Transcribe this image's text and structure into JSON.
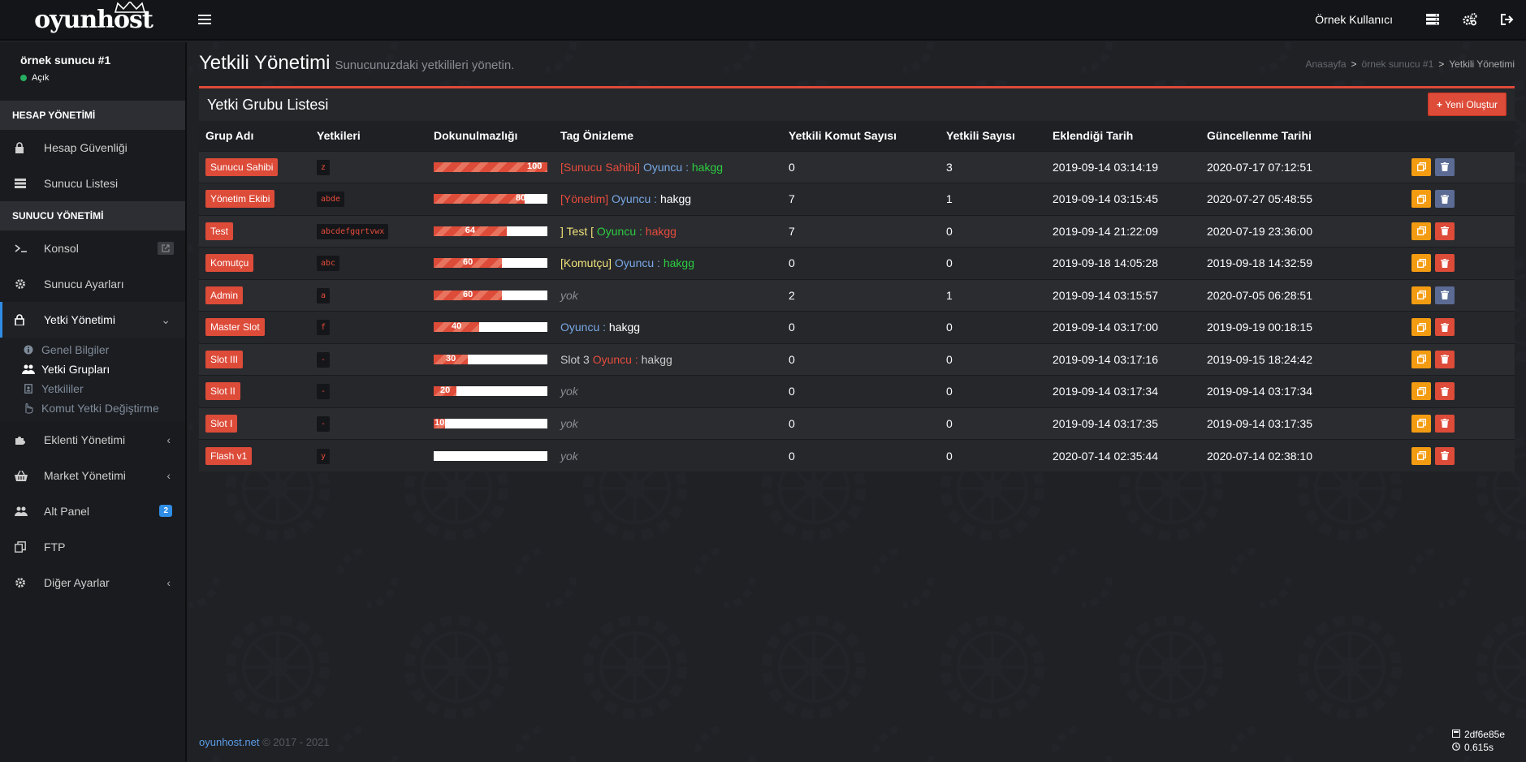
{
  "brand": {
    "logo_text": "oyunhost"
  },
  "header": {
    "user_name": "Örnek Kullanıcı",
    "icons": [
      "server-list-icon",
      "settings-cogs-icon",
      "logout-icon"
    ]
  },
  "sidebar": {
    "server_name": "örnek sunucu #1",
    "server_status": "Açık",
    "sections": {
      "account": "HESAP YÖNETİMİ",
      "server": "SUNUCU YÖNETİMİ"
    },
    "account_items": [
      {
        "label": "Hesap Güvenliği",
        "icon": "lock-icon"
      },
      {
        "label": "Sunucu Listesi",
        "icon": "server-list-icon"
      }
    ],
    "server_items": [
      {
        "label": "Konsol",
        "icon": "terminal-icon"
      },
      {
        "label": "Sunucu Ayarları",
        "icon": "gear-icon"
      },
      {
        "label": "Yetki Yönetimi",
        "icon": "lock-icon"
      }
    ],
    "sub_items": [
      {
        "label": "Genel Bilgiler",
        "icon": "info-icon"
      },
      {
        "label": "Yetki Grupları",
        "icon": "users-icon"
      },
      {
        "label": "Yetkililer",
        "icon": "badge-icon"
      },
      {
        "label": "Komut Yetki Değiştirme",
        "icon": "hand-icon"
      }
    ],
    "lower_items": [
      {
        "label": "Eklenti Yönetimi",
        "icon": "puzzle-icon"
      },
      {
        "label": "Market Yönetimi",
        "icon": "basket-icon"
      },
      {
        "label": "Alt Panel",
        "icon": "users-icon",
        "badge": "2"
      },
      {
        "label": "FTP",
        "icon": "copy-icon"
      },
      {
        "label": "Diğer Ayarlar",
        "icon": "gear-icon"
      }
    ]
  },
  "page": {
    "title": "Yetkili Yönetimi",
    "subtitle": "Sunucunuzdaki yetkilileri yönetin.",
    "breadcrumb": [
      "Anasayfa",
      "örnek sunucu #1",
      "Yetkili Yönetimi"
    ]
  },
  "box": {
    "title": "Yetki Grubu Listesi",
    "new_button": "Yeni Oluştur"
  },
  "table": {
    "columns": [
      "Grup Adı",
      "Yetkileri",
      "Dokunulmazlığı",
      "Tag Önizleme",
      "Yetkili Komut Sayısı",
      "Yetkili Sayısı",
      "Eklendiği Tarih",
      "Güncellenme Tarihi"
    ],
    "rows": [
      {
        "name": "Sunucu Sahibi",
        "flags": "z",
        "immunity": 100,
        "tag": [
          [
            "[Sunucu Sahibi] ",
            "red"
          ],
          [
            "Oyuncu : ",
            "blue"
          ],
          [
            "hakgg",
            "green"
          ]
        ],
        "cmd_count": "0",
        "admin_count": "3",
        "added": "2019-09-14 03:14:19",
        "updated": "2020-07-17 07:12:51",
        "deletable": false
      },
      {
        "name": "Yönetim Ekibi",
        "flags": "abde",
        "immunity": 80,
        "tag": [
          [
            "[Yönetim] ",
            "red"
          ],
          [
            "Oyuncu : ",
            "blue"
          ],
          [
            "hakgg",
            "white"
          ]
        ],
        "cmd_count": "7",
        "admin_count": "1",
        "added": "2019-09-14 03:15:45",
        "updated": "2020-07-27 05:48:55",
        "deletable": false
      },
      {
        "name": "Test",
        "flags": "abcdefgqrtvwx",
        "immunity": 64,
        "tag": [
          [
            "] Test [ ",
            "yellow"
          ],
          [
            "Oyuncu : ",
            "green"
          ],
          [
            "hakgg",
            "red"
          ]
        ],
        "cmd_count": "7",
        "admin_count": "0",
        "added": "2019-09-14 21:22:09",
        "updated": "2020-07-19 23:36:00",
        "deletable": true
      },
      {
        "name": "Komutçu",
        "flags": "abc",
        "immunity": 60,
        "tag": [
          [
            "[Komutçu] ",
            "yellow"
          ],
          [
            "Oyuncu : ",
            "blue"
          ],
          [
            "hakgg",
            "green"
          ]
        ],
        "cmd_count": "0",
        "admin_count": "0",
        "added": "2019-09-18 14:05:28",
        "updated": "2019-09-18 14:32:59",
        "deletable": true
      },
      {
        "name": "Admin",
        "flags": "a",
        "immunity": 60,
        "tag": [
          [
            "yok",
            "italic"
          ]
        ],
        "cmd_count": "2",
        "admin_count": "1",
        "added": "2019-09-14 03:15:57",
        "updated": "2020-07-05 06:28:51",
        "deletable": false
      },
      {
        "name": "Master Slot",
        "flags": "f",
        "immunity": 40,
        "tag": [
          [
            "Oyuncu : ",
            "blue"
          ],
          [
            "hakgg",
            "white"
          ]
        ],
        "cmd_count": "0",
        "admin_count": "0",
        "added": "2019-09-14 03:17:00",
        "updated": "2019-09-19 00:18:15",
        "deletable": true
      },
      {
        "name": "Slot III",
        "flags": "-",
        "immunity": 30,
        "tag": [
          [
            "Slot 3 ",
            "gray"
          ],
          [
            "Oyuncu : ",
            "red"
          ],
          [
            "hakgg",
            "gray"
          ]
        ],
        "cmd_count": "0",
        "admin_count": "0",
        "added": "2019-09-14 03:17:16",
        "updated": "2019-09-15 18:24:42",
        "deletable": true
      },
      {
        "name": "Slot II",
        "flags": "-",
        "immunity": 20,
        "tag": [
          [
            "yok",
            "italic"
          ]
        ],
        "cmd_count": "0",
        "admin_count": "0",
        "added": "2019-09-14 03:17:34",
        "updated": "2019-09-14 03:17:34",
        "deletable": true
      },
      {
        "name": "Slot I",
        "flags": "-",
        "immunity": 10,
        "tag": [
          [
            "yok",
            "italic"
          ]
        ],
        "cmd_count": "0",
        "admin_count": "0",
        "added": "2019-09-14 03:17:35",
        "updated": "2019-09-14 03:17:35",
        "deletable": true
      },
      {
        "name": "Flash v1",
        "flags": "y",
        "immunity": 0,
        "tag": [
          [
            "yok",
            "italic"
          ]
        ],
        "cmd_count": "0",
        "admin_count": "0",
        "added": "2020-07-14 02:35:44",
        "updated": "2020-07-14 02:38:10",
        "deletable": true
      }
    ]
  },
  "footer": {
    "link": "oyunhost.net",
    "copyright": "© 2017 - 2021",
    "build_hash": "2df6e85e",
    "render_time": "0.615s"
  },
  "colors": {
    "accent_red": "#dd4b39",
    "accent_blue": "#2f8de4",
    "copy_orange": "#f39c12",
    "disabled_delete": "#5b6b94"
  }
}
